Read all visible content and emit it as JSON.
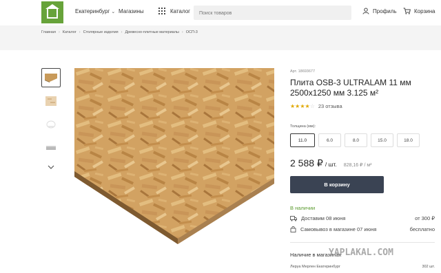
{
  "header": {
    "logo_text": "LEROY MERLIN",
    "city": "Екатеринбург",
    "stores": "Магазины",
    "catalog": "Каталог",
    "search_placeholder": "Поиск товаров",
    "profile": "Профиль",
    "cart": "Корзина"
  },
  "breadcrumb": [
    "Главная",
    "Каталог",
    "Столярные изделия",
    "Древесно-плитные материалы",
    "ОСП-3"
  ],
  "product": {
    "article": "Арт. 18693677",
    "title": "Плита OSB-3 ULTRALAM 11 мм 2500x1250 мм 3.125 м²",
    "rating": 3.5,
    "reviews": "23 отзыва",
    "thickness_label": "Толщина (мм):",
    "thickness_options": [
      "11.0",
      "6.0",
      "8.0",
      "15.0",
      "18.0"
    ],
    "selected_thickness": "11.0",
    "price": "2 588 ₽",
    "price_unit": "/ шт.",
    "price_per_m2": "828,16 ₽ / м²",
    "buy_button": "В корзину",
    "in_stock": "В наличии",
    "delivery_label": "Доставим 08 июня",
    "delivery_price": "от 300 ₽",
    "pickup_label": "Самовывоз в магазине 07 июня",
    "pickup_price": "бесплатно",
    "availability_title": "Наличие в магазинах",
    "store_name": "Леруа Мерлен Екатеринбург",
    "store_qty": "302 шт."
  },
  "watermark": "YAPLAKAL.COM",
  "colors": {
    "brand_green": "#67a33a",
    "button_dark": "#3a4353",
    "star": "#e0a800",
    "in_stock_green": "#5a9a2e"
  }
}
